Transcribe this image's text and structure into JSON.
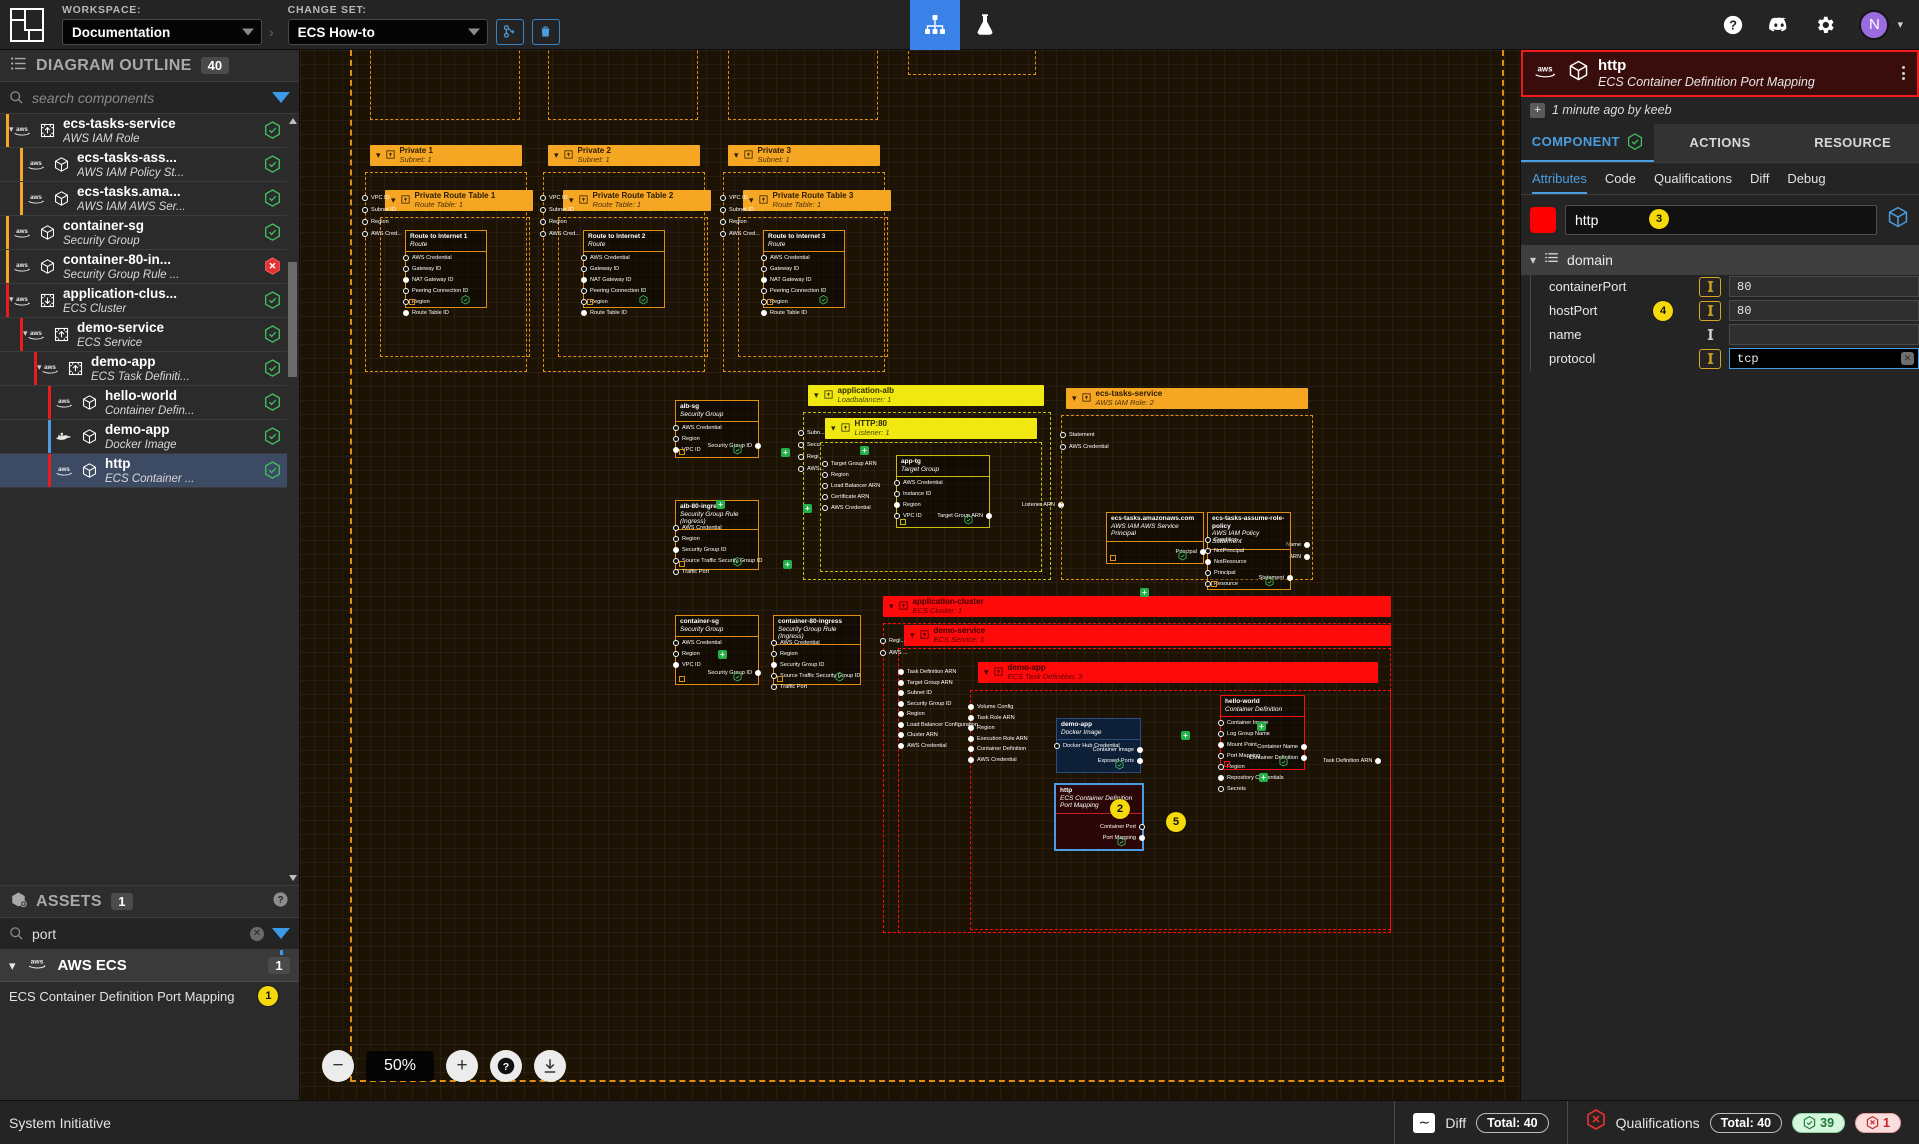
{
  "topbar": {
    "logo_name": "system-initiative-logo",
    "workspace_label": "WORKSPACE:",
    "workspace_value": "Documentation",
    "changeset_label": "CHANGE SET:",
    "changeset_value": "ECS How-to",
    "merge_button": "merge-changeset-button",
    "delete_button": "delete-changeset-button",
    "tabs": [
      {
        "name": "diagram-tab",
        "icon": "sitemap-icon",
        "active": true
      },
      {
        "name": "lab-tab",
        "icon": "flask-icon",
        "active": false
      }
    ],
    "help_icon": "help-icon",
    "discord_icon": "discord-icon",
    "settings_icon": "gear-icon",
    "avatar_initial": "N"
  },
  "outline": {
    "title": "DIAGRAM OUTLINE",
    "count": "40",
    "search_placeholder": "search components",
    "search_value": "",
    "items": [
      {
        "name": "ecs-tasks-service",
        "type": "AWS IAM Role",
        "status": "ok",
        "icon": "aws-frame-up-icon",
        "vendor": "aws",
        "indent": 0,
        "bar": "#f5a623",
        "expanded": true
      },
      {
        "name": "ecs-tasks-ass...",
        "type": "AWS IAM Policy St...",
        "status": "ok",
        "icon": "aws-cube-icon",
        "vendor": "aws",
        "indent": 1,
        "bar": "#f5a623",
        "expanded": false
      },
      {
        "name": "ecs-tasks.ama...",
        "type": "AWS IAM AWS Ser...",
        "status": "ok",
        "icon": "aws-cube-icon",
        "vendor": "aws",
        "indent": 1,
        "bar": "#f5a623",
        "expanded": false
      },
      {
        "name": "container-sg",
        "type": "Security Group",
        "status": "ok",
        "icon": "aws-cube-icon",
        "vendor": "aws",
        "indent": 0,
        "bar": "#f5a623",
        "expanded": false
      },
      {
        "name": "container-80-in...",
        "type": "Security Group Rule ...",
        "status": "error",
        "icon": "aws-cube-icon",
        "vendor": "aws",
        "indent": 0,
        "bar": "#f5a623",
        "expanded": false
      },
      {
        "name": "application-clus...",
        "type": "ECS Cluster",
        "status": "ok",
        "icon": "aws-frame-down-icon",
        "vendor": "aws",
        "indent": 0,
        "bar": "#e81c1c",
        "expanded": true
      },
      {
        "name": "demo-service",
        "type": "ECS Service",
        "status": "ok",
        "icon": "aws-frame-up-icon",
        "vendor": "aws",
        "indent": 1,
        "bar": "#e81c1c",
        "expanded": true
      },
      {
        "name": "demo-app",
        "type": "ECS Task Definiti...",
        "status": "ok",
        "icon": "aws-frame-up-icon",
        "vendor": "aws",
        "indent": 2,
        "bar": "#e81c1c",
        "expanded": true
      },
      {
        "name": "hello-world",
        "type": "Container Defin...",
        "status": "ok",
        "icon": "aws-cube-icon",
        "vendor": "aws",
        "indent": 3,
        "bar": "#e81c1c",
        "expanded": false
      },
      {
        "name": "demo-app",
        "type": "Docker Image",
        "status": "ok",
        "icon": "docker-cube-icon",
        "vendor": "docker",
        "indent": 3,
        "bar": "#4a9ee0",
        "expanded": false
      },
      {
        "name": "http",
        "type": "ECS Container ...",
        "status": "ok",
        "icon": "aws-cube-icon",
        "vendor": "aws",
        "indent": 3,
        "bar": "#e81c1c",
        "expanded": false,
        "selected": true
      }
    ]
  },
  "assets": {
    "title": "ASSETS",
    "count": "1",
    "help_icon": "help-icon",
    "search_placeholder": "search assets",
    "search_value": "port",
    "groups": [
      {
        "name": "AWS ECS",
        "count": "1",
        "items": [
          {
            "label": "ECS Container Definition Port Mapping",
            "badge": "1"
          }
        ]
      }
    ]
  },
  "canvas": {
    "zoom_level": "50%",
    "zoom_out_icon": "minus-icon",
    "zoom_in_icon": "plus-icon",
    "help_icon": "help-icon",
    "download_icon": "download-icon",
    "frames": [
      {
        "name": "Private 1",
        "sub": "Subnet: 1"
      },
      {
        "name": "Private 2",
        "sub": "Subnet: 1"
      },
      {
        "name": "Private 3",
        "sub": "Subnet: 1"
      },
      {
        "name": "Private Route Table 1",
        "sub": "Route Table: 1"
      },
      {
        "name": "Private Route Table 2",
        "sub": "Route Table: 1"
      },
      {
        "name": "Private Route Table 3",
        "sub": "Route Table: 1"
      },
      {
        "name": "application-alb",
        "sub": "Loadbalancer: 1"
      },
      {
        "name": "HTTP:80",
        "sub": "Listener: 1"
      },
      {
        "name": "ecs-tasks-service",
        "sub": "AWS IAM Role: 2"
      },
      {
        "name": "application-cluster",
        "sub": "ECS Cluster: 1"
      },
      {
        "name": "demo-service",
        "sub": "ECS Service: 1"
      },
      {
        "name": "demo-app",
        "sub": "ECS Task Definition: 3"
      }
    ],
    "components": [
      {
        "name": "Route to Internet 1",
        "sub": "Route"
      },
      {
        "name": "Route to Internet 2",
        "sub": "Route"
      },
      {
        "name": "Route to Internet 3",
        "sub": "Route"
      },
      {
        "name": "alb-sg",
        "sub": "Security Group"
      },
      {
        "name": "alb-80-ingress",
        "sub": "Security Group Rule (Ingress)"
      },
      {
        "name": "container-sg",
        "sub": "Security Group"
      },
      {
        "name": "container-80-ingress",
        "sub": "Security Group Rule (Ingress)"
      },
      {
        "name": "app-tg",
        "sub": "Target Group"
      },
      {
        "name": "ecs-tasks.amazonaws.com",
        "sub": "AWS IAM AWS Service Principal"
      },
      {
        "name": "ecs-tasks-assume-role-policy",
        "sub": "AWS IAM Policy Statement"
      },
      {
        "name": "demo-app",
        "sub": "Docker Image"
      },
      {
        "name": "hello-world",
        "sub": "Container Definition"
      },
      {
        "name": "http",
        "sub": "ECS Container Definition Port Mapping"
      }
    ],
    "sockets": {
      "route": [
        "AWS Credential",
        "Gateway ID",
        "NAT Gateway ID",
        "Peering Connection ID",
        "Region",
        "Route Table ID"
      ],
      "route_table_in": [
        "VPC ID",
        "Subnet ID",
        "Region",
        "AWS Cred..."
      ],
      "subnet_in": [
        "VPC ID",
        "Region",
        "AWS ..."
      ],
      "alb_sg": [
        "AWS Credential",
        "Region",
        "VPC ID"
      ],
      "alb_sg_out": "Security Group ID",
      "alb_ingress": [
        "AWS Credential",
        "Region",
        "Security Group ID",
        "Source Traffic Security Group ID",
        "Traffic Port"
      ],
      "container_sg": [
        "AWS Credential",
        "Region",
        "VPC ID"
      ],
      "container_sg_out": "Security Group ID",
      "container_ingress": [
        "AWS Credential",
        "Region",
        "Security Group ID",
        "Source Traffic Security Group ID",
        "Traffic Port"
      ],
      "listener_in": [
        "Target Group ARN",
        "Region",
        "Load Balancer ARN",
        "Certificate ARN",
        "AWS Credential"
      ],
      "alb_in": [
        "Subn...",
        "Secu...",
        "Regi...",
        "AWS..."
      ],
      "app_tg_in": [
        "AWS Credential",
        "Instance ID",
        "Region",
        "VPC ID"
      ],
      "app_tg_out": "Target Group ARN",
      "listener_out": "Listener ARN",
      "iam_role_in": [
        "Statement",
        "AWS Credential"
      ],
      "iam_role_out": [
        "Name",
        "ARN"
      ],
      "principal_out": "Principal",
      "policy_in": [
        "Condition",
        "NotPrincipal",
        "NotResource",
        "Principal",
        "Resource"
      ],
      "policy_out": "Statement",
      "service_in": [
        "Task Definition ARN",
        "Target Group ARN",
        "Subnet ID",
        "Security Group ID",
        "Region",
        "Load Balancer Configuration",
        "Cluster ARN",
        "AWS Credential"
      ],
      "taskdef_in": [
        "Volume Config",
        "Task Role ARN",
        "Region",
        "Execution Role ARN",
        "Container Definition",
        "AWS Credential"
      ],
      "taskdef_out": "Task Definition ARN",
      "docker_in": [
        "Docker Hub Credential"
      ],
      "docker_out": [
        "Container Image",
        "Exposed Ports"
      ],
      "containerdef_in": [
        "Container Image",
        "Log Group Name",
        "Mount Point",
        "Port Mapping",
        "Region",
        "Repository Credentials",
        "Secrets"
      ],
      "containerdef_out": [
        "Container Definition",
        "Container Name"
      ],
      "portmap_out": [
        "Container Port",
        "Port Mapping"
      ],
      "cluster_in": [
        "Regi...",
        "AWS ..."
      ]
    },
    "callouts": [
      "1",
      "2",
      "3",
      "4",
      "5"
    ]
  },
  "details": {
    "header_name": "http",
    "header_sub": "ECS Container Definition Port Mapping",
    "vendor_icon": "aws-logo-icon",
    "cube_icon": "cube-icon",
    "kebab_icon": "kebab-menu-icon",
    "meta": "1 minute ago by keeb",
    "tabs": [
      {
        "label": "COMPONENT",
        "active": true,
        "status": "ok"
      },
      {
        "label": "ACTIONS",
        "active": false
      },
      {
        "label": "RESOURCE",
        "active": false
      }
    ],
    "subtabs": [
      {
        "label": "Attributes",
        "active": true
      },
      {
        "label": "Code",
        "active": false
      },
      {
        "label": "Qualifications",
        "active": false
      },
      {
        "label": "Diff",
        "active": false
      },
      {
        "label": "Debug",
        "active": false
      }
    ],
    "component_color": "#ff0000",
    "name_value": "http",
    "section_label": "domain",
    "attributes": [
      {
        "key": "containerPort",
        "value": "80",
        "boxed": true,
        "focused": false
      },
      {
        "key": "hostPort",
        "value": "80",
        "boxed": true,
        "focused": false
      },
      {
        "key": "name",
        "value": "",
        "boxed": false,
        "focused": false
      },
      {
        "key": "protocol",
        "value": "tcp",
        "boxed": true,
        "focused": true
      }
    ]
  },
  "statusbar": {
    "brand": "System Initiative",
    "diff_label": "Diff",
    "diff_icon": "wave-icon",
    "diff_total": "Total:  40",
    "qual_label": "Qualifications",
    "qual_icon": "hex-error-icon",
    "qual_total": "Total:  40",
    "qual_pass": "39",
    "qual_fail": "1"
  }
}
